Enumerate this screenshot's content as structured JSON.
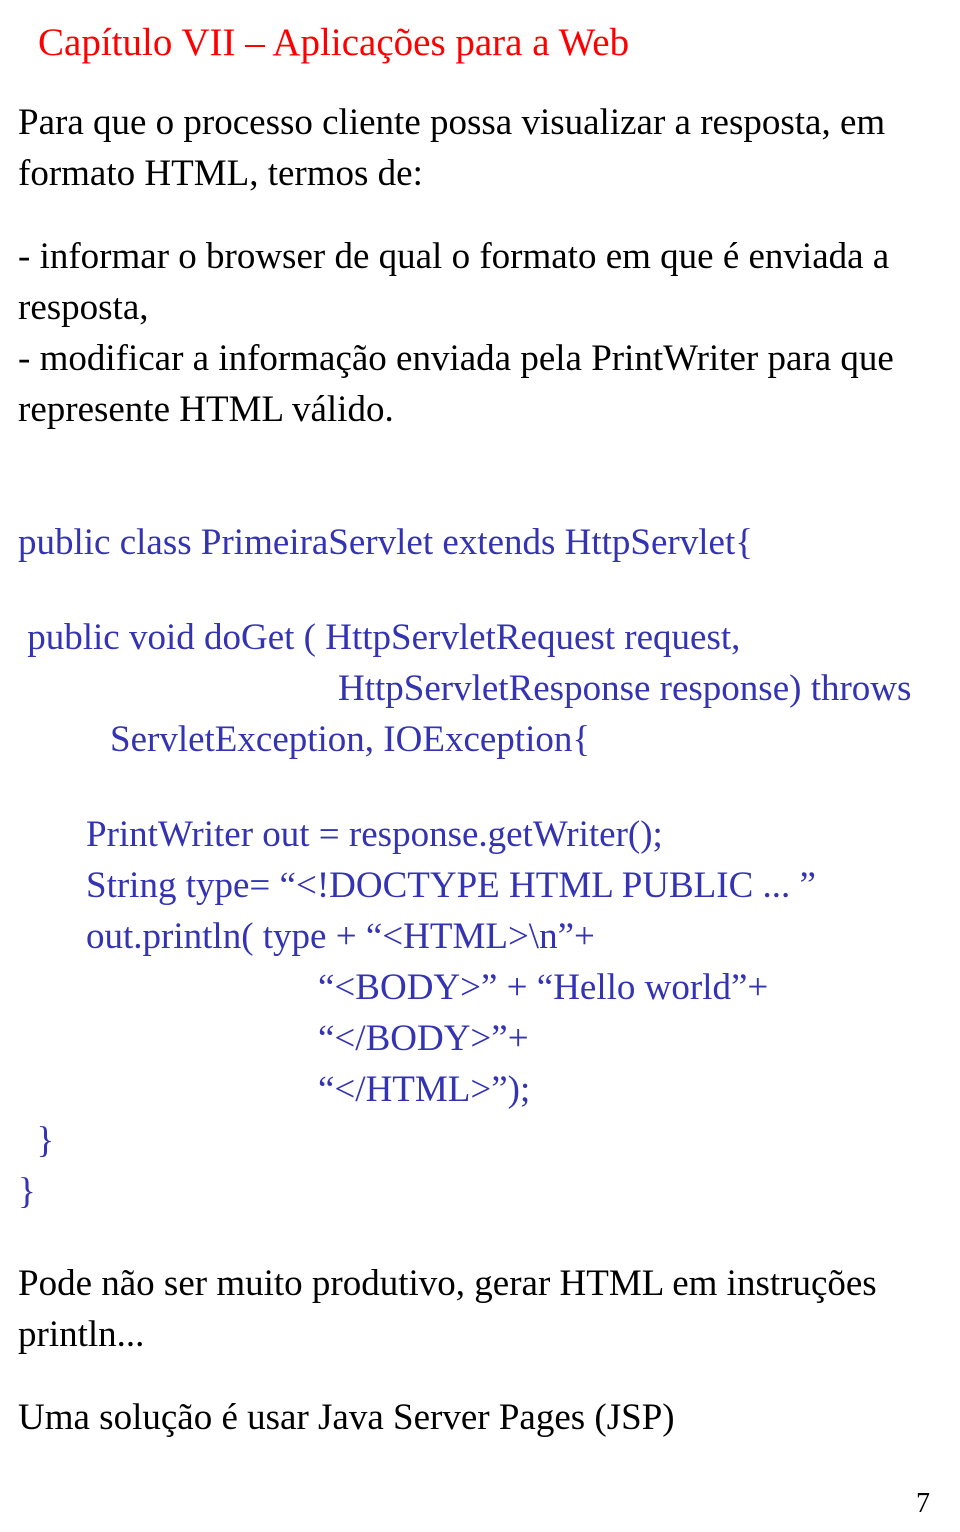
{
  "title": "Capítulo VII – Aplicações para a Web",
  "intro": "Para que o processo cliente possa visualizar a resposta, em formato HTML, termos de:",
  "bullets": "- informar o browser de qual o formato em que é enviada a resposta,\n- modificar a informação enviada pela PrintWriter para que represente HTML válido.",
  "code": {
    "l1": "public class PrimeiraServlet extends HttpServlet{",
    "l2": " public void doGet ( HttpServletRequest request,",
    "l3": "HttpServletResponse response) throws",
    "l4": "ServletException, IOException{",
    "l5": "PrintWriter out = response.getWriter();",
    "l6": "String type= “<!DOCTYPE HTML PUBLIC ... ”",
    "l7": "out.println( type + “<HTML>\\n”+",
    "l8": "“<BODY>” + “Hello world”+",
    "l9": "“</BODY>”+",
    "l10": "“</HTML>”);",
    "l11": "  }",
    "l12": "}"
  },
  "concl1": "Pode não ser muito produtivo, gerar HTML em instruções println...",
  "concl2": "Uma solução é usar Java Server Pages (JSP)",
  "pageNumber": "7"
}
